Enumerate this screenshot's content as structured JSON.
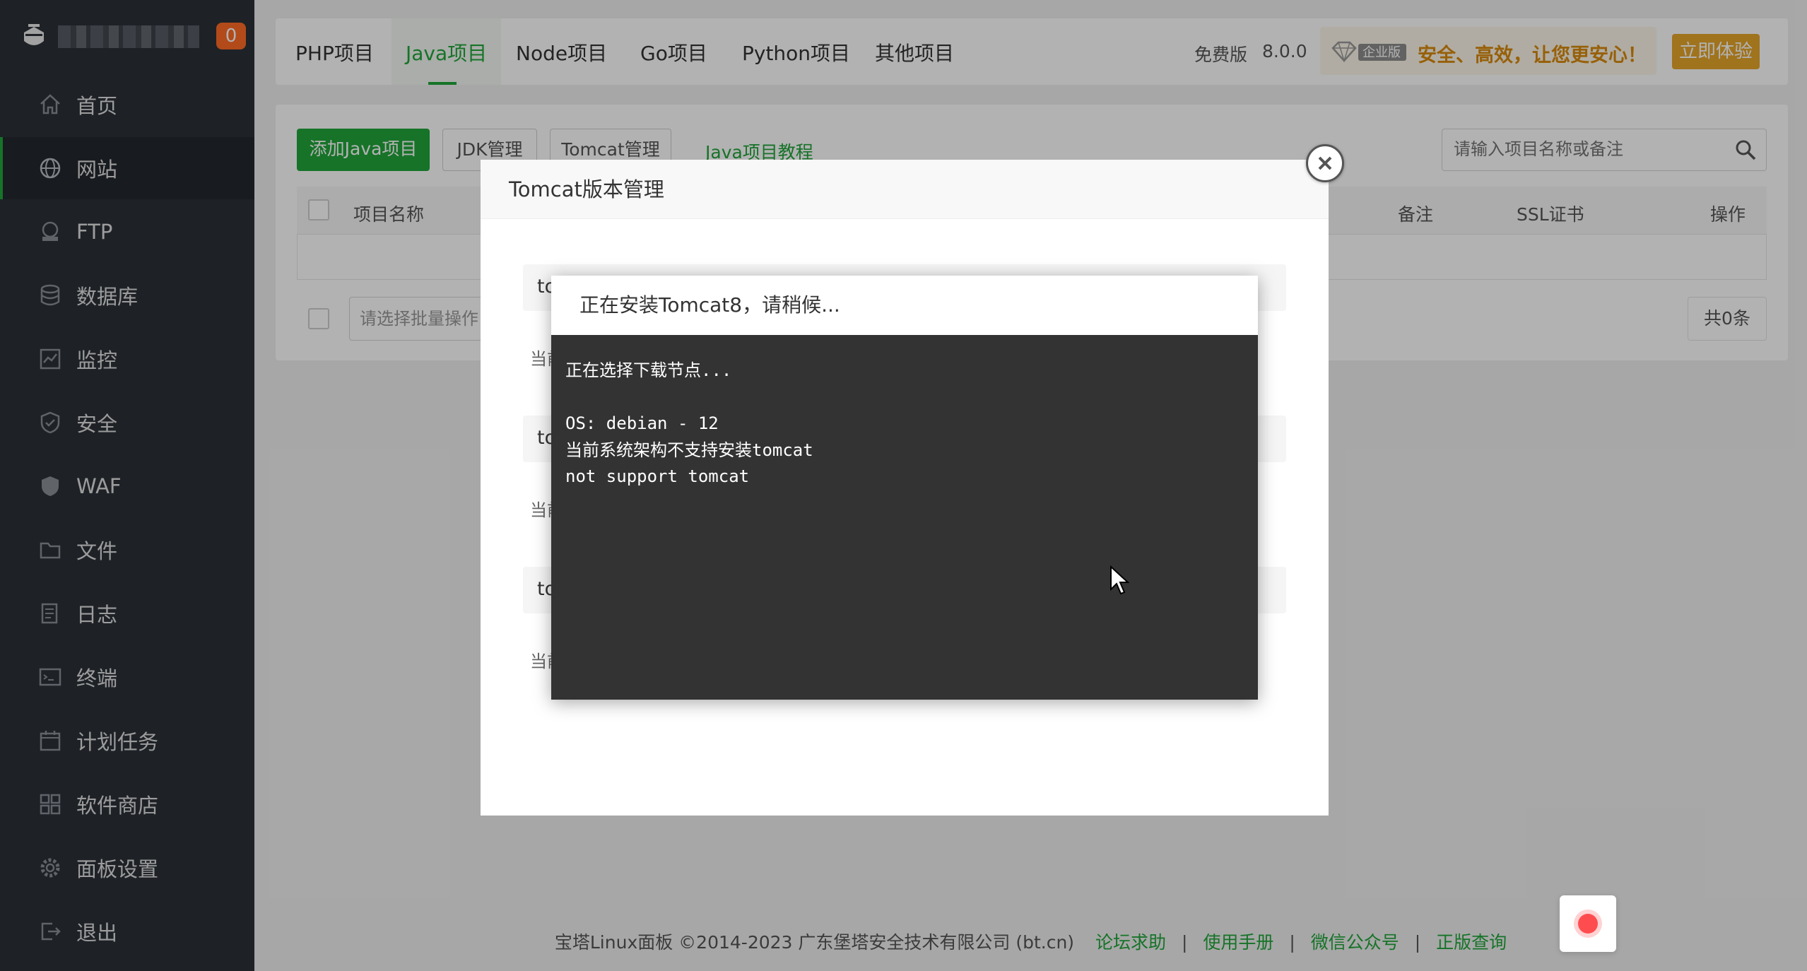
{
  "sidebar": {
    "badge": "0",
    "items": [
      {
        "label": "首页",
        "icon": "home-icon"
      },
      {
        "label": "网站",
        "icon": "globe-icon",
        "active": true
      },
      {
        "label": "FTP",
        "icon": "ftp-icon"
      },
      {
        "label": "数据库",
        "icon": "database-icon"
      },
      {
        "label": "监控",
        "icon": "monitor-icon"
      },
      {
        "label": "安全",
        "icon": "shield-check-icon"
      },
      {
        "label": "WAF",
        "icon": "waf-shield-icon"
      },
      {
        "label": "文件",
        "icon": "folder-icon"
      },
      {
        "label": "日志",
        "icon": "log-icon"
      },
      {
        "label": "终端",
        "icon": "terminal-icon"
      },
      {
        "label": "计划任务",
        "icon": "calendar-icon"
      },
      {
        "label": "软件商店",
        "icon": "app-store-icon"
      },
      {
        "label": "面板设置",
        "icon": "gear-icon"
      },
      {
        "label": "退出",
        "icon": "logout-icon"
      }
    ]
  },
  "topbar": {
    "tabs": [
      "PHP项目",
      "Java项目",
      "Node项目",
      "Go项目",
      "Python项目",
      "其他项目"
    ],
    "active_tab": "Java项目",
    "version_label": "免费版",
    "version": "8.0.0",
    "enterprise_badge": "企业版",
    "promo": "安全、高效，让您更安心！",
    "trial_button": "立即体验"
  },
  "toolbar": {
    "add_java": "添加Java项目",
    "jdk": "JDK管理",
    "tomcat": "Tomcat管理",
    "tutorial": "Java项目教程",
    "search_placeholder": "请输入项目名称或备注"
  },
  "table": {
    "headers": {
      "name": "项目名称",
      "remark": "备注",
      "ssl": "SSL证书",
      "action": "操作"
    },
    "batch_placeholder": "请选择批量操作",
    "total": "共0条"
  },
  "version_dialog": {
    "title": "Tomcat版本管理",
    "rows": [
      {
        "prefix": "to"
      },
      {
        "prefix": "to"
      },
      {
        "prefix": "to"
      }
    ],
    "sub_prefix": "当前"
  },
  "install_dialog": {
    "title": "正在安装Tomcat8，请稍候...",
    "log": [
      "正在选择下载节点...",
      "",
      "OS: debian - 12",
      "当前系统架构不支持安装tomcat",
      "not support tomcat"
    ]
  },
  "footer": {
    "copyright": "宝塔Linux面板 ©2014-2023 广东堡塔安全技术有限公司 (bt.cn)",
    "links": [
      "论坛求助",
      "使用手册",
      "微信公众号",
      "正版查询"
    ],
    "separator": "|"
  },
  "colors": {
    "accent": "#20a53a",
    "sidebar_bg": "#2c3138",
    "badge": "#ff6a26",
    "promo": "#d98a0c",
    "trial_button": "#e5a52a",
    "terminal_bg": "#333333"
  }
}
